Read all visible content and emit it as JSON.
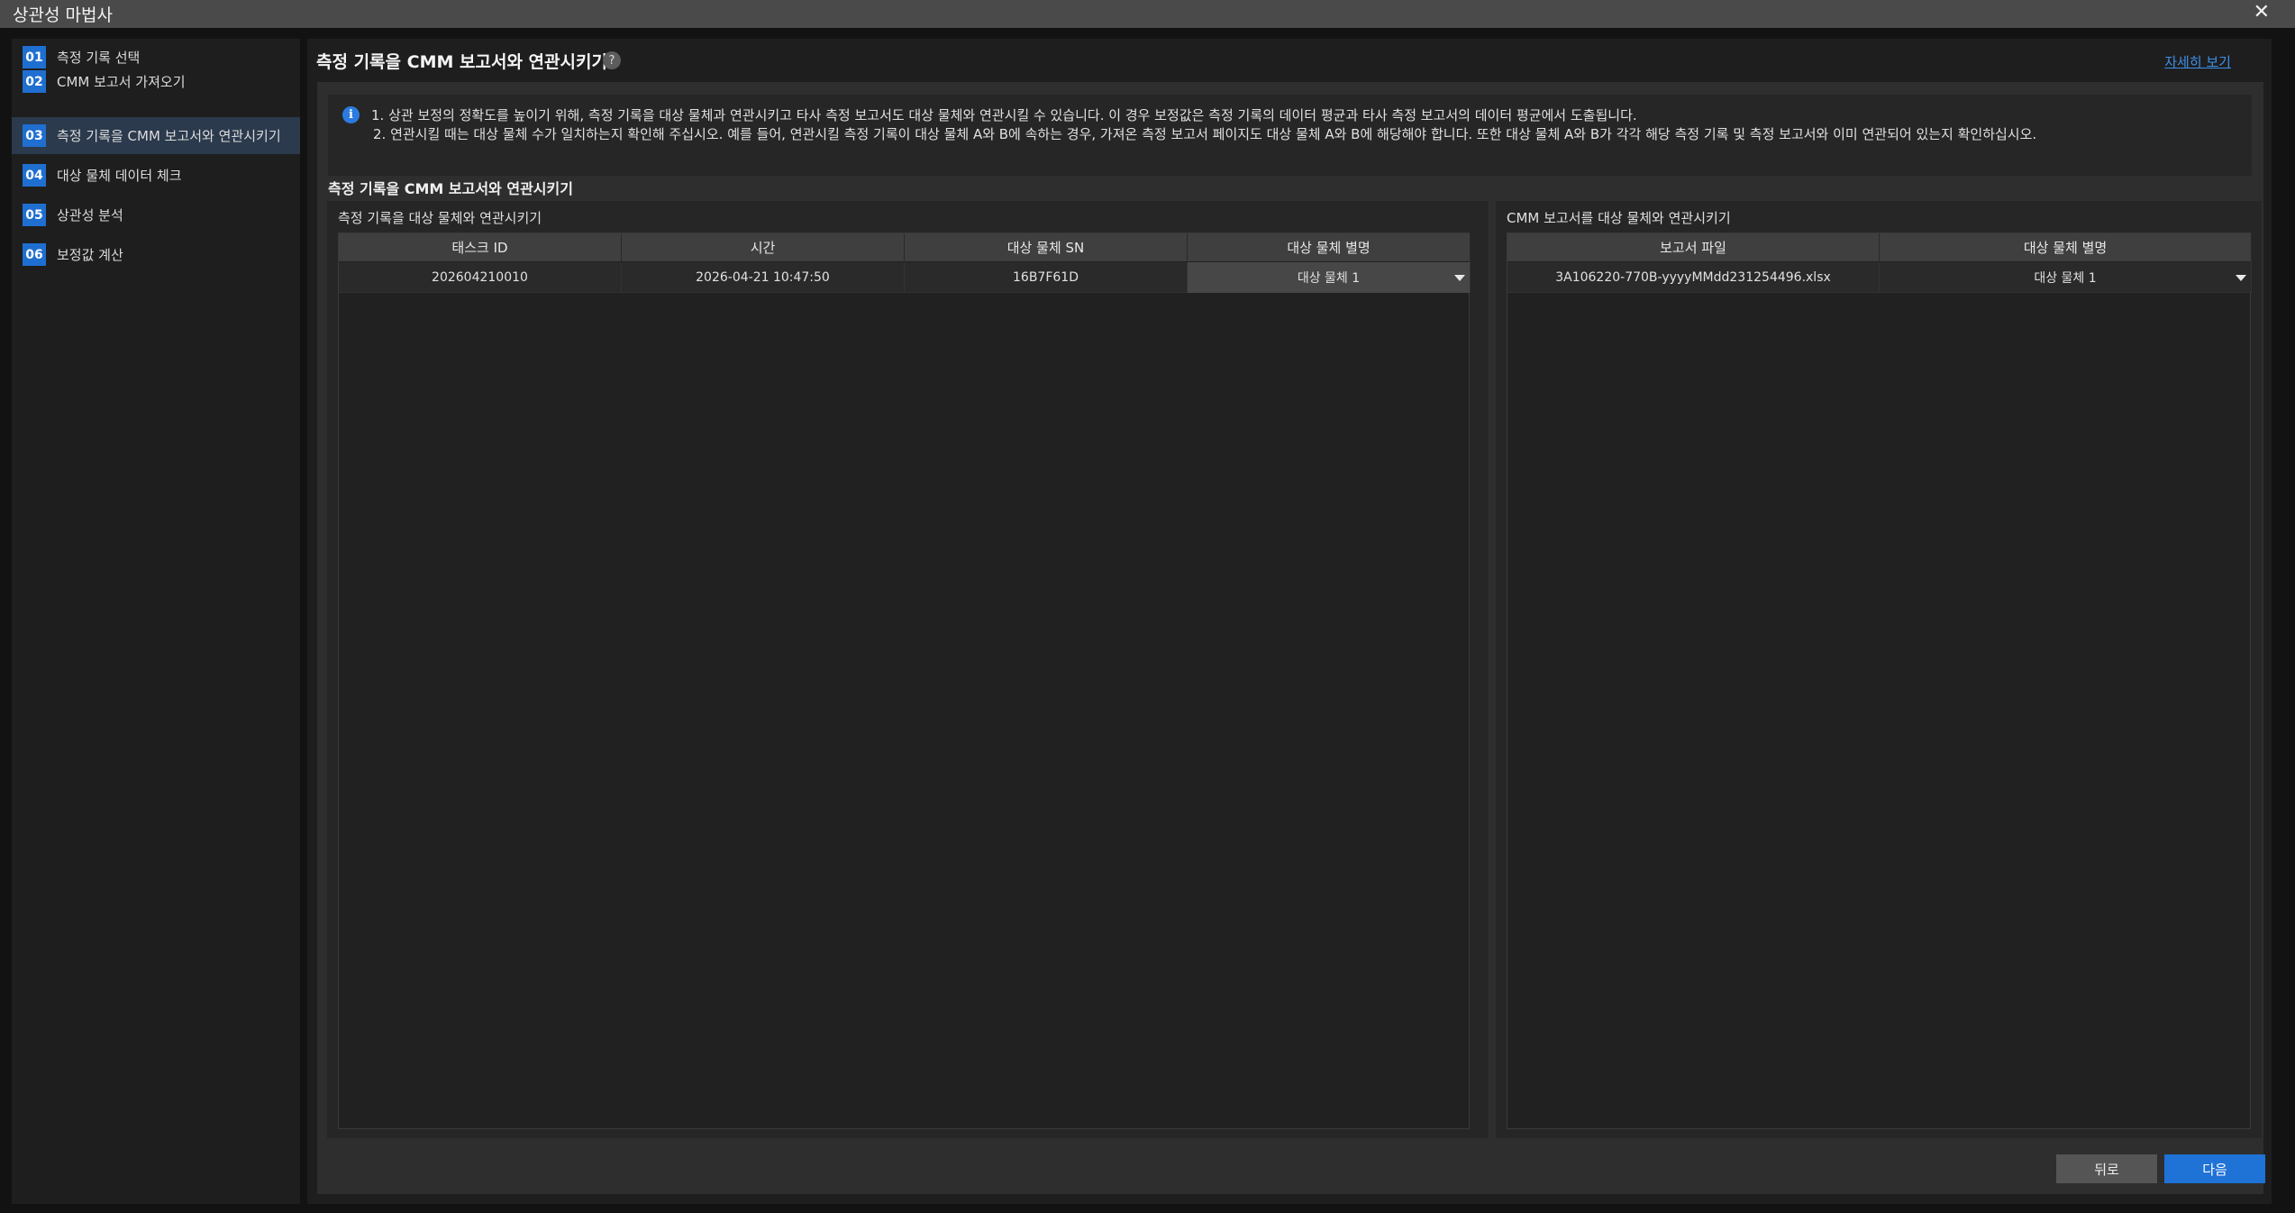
{
  "window": {
    "title": "상관성 마법사",
    "close_label": "✕"
  },
  "sidebar": {
    "steps": [
      {
        "num": "01",
        "label": "측정 기록 선택"
      },
      {
        "num": "02",
        "label": "CMM 보고서 가져오기"
      },
      {
        "num": "03",
        "label": "측정 기록을 CMM 보고서와 연관시키기",
        "active": true
      },
      {
        "num": "04",
        "label": "대상 물체 데이터 체크"
      },
      {
        "num": "05",
        "label": "상관성 분석"
      },
      {
        "num": "06",
        "label": "보정값 계산"
      }
    ]
  },
  "main": {
    "title": "측정 기록을 CMM 보고서와 연관시키기",
    "help_icon": "?",
    "details_link": "자세히 보기",
    "info": {
      "icon": "i",
      "line1": "1. 상관 보정의 정확도를 높이기 위해, 측정 기록을 대상 물체과 연관시키고 타사 측정 보고서도 대상 물체와 연관시킬 수 있습니다. 이 경우 보정값은 측정 기록의 데이터 평균과 타사 측정 보고서의 데이터 평균에서 도출됩니다.",
      "line2": "2. 연관시킬 때는 대상 물체 수가 일치하는지 확인해 주십시오. 예를 들어, 연관시킬 측정 기록이 대상 물체 A와 B에 속하는 경우, 가져온 측정 보고서 페이지도 대상 물체 A와 B에 해당해야 합니다. 또한 대상 물체 A와 B가 각각 해당 측정 기록 및 측정 보고서와 이미 연관되어 있는지 확인하십시오."
    },
    "section_title": "측정 기록을 CMM 보고서와 연관시키기",
    "left_panel": {
      "title": "측정 기록을 대상 물체와 연관시키기",
      "columns": [
        "태스크 ID",
        "시간",
        "대상 물체 SN",
        "대상 물체 별명"
      ],
      "rows": [
        {
          "task_id": "202604210010",
          "time": "2026-04-21 10:47:50",
          "sn": "16B7F61D",
          "alias": "대상 물체 1"
        }
      ]
    },
    "right_panel": {
      "title": "CMM 보고서를 대상 물체와 연관시키기",
      "columns": [
        "보고서 파일",
        "대상 물체 별명"
      ],
      "rows": [
        {
          "file": "3A106220-770B-yyyyMMdd231254496.xlsx",
          "alias": "대상 물체 1"
        }
      ]
    }
  },
  "footer": {
    "back_label": "뒤로",
    "next_label": "다음"
  },
  "colors": {
    "accent": "#1f72d6",
    "link": "#3d8fe8",
    "active_step_bg": "#2b3a4d"
  }
}
